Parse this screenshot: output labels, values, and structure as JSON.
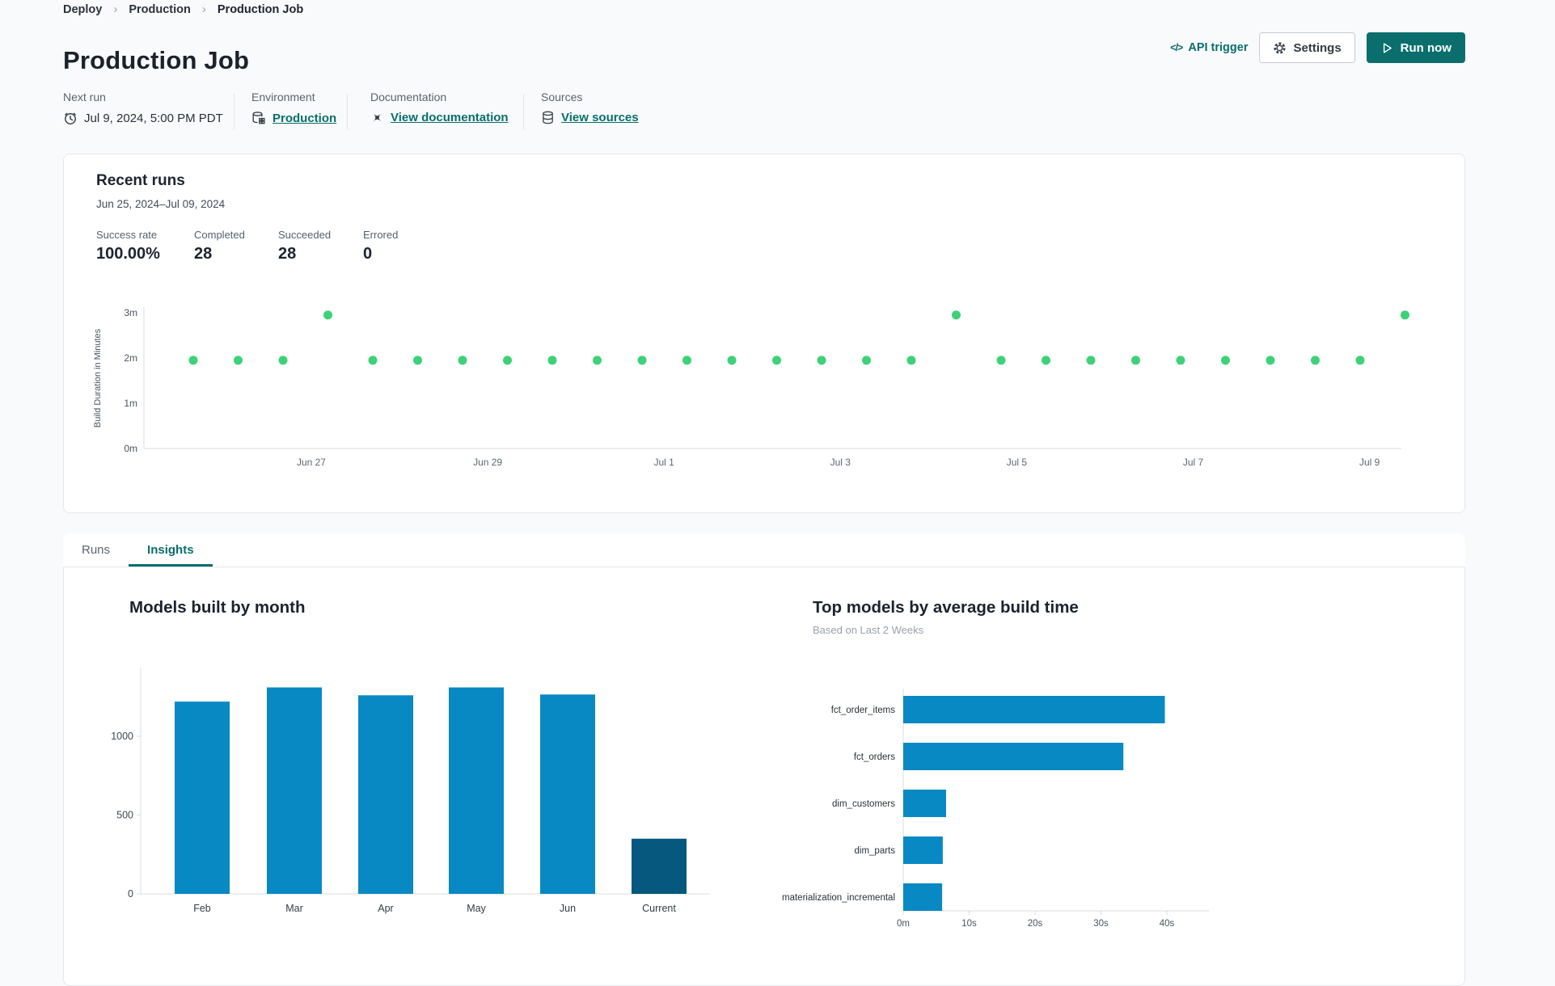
{
  "breadcrumb": {
    "items": [
      "Deploy",
      "Production",
      "Production Job"
    ]
  },
  "header": {
    "title": "Production Job",
    "api_trigger_label": "API trigger",
    "code_glyph": "</>",
    "settings_label": "Settings",
    "run_now_label": "Run now"
  },
  "info": {
    "next_run": {
      "label": "Next run",
      "value": "Jul 9, 2024, 5:00 PM PDT"
    },
    "environment": {
      "label": "Environment",
      "value": "Production"
    },
    "documentation": {
      "label": "Documentation",
      "value": "View documentation"
    },
    "sources": {
      "label": "Sources",
      "value": "View sources"
    }
  },
  "recent_runs": {
    "title": "Recent runs",
    "date_range": "Jun 25, 2024–Jul 09, 2024",
    "stats": [
      {
        "label": "Success rate",
        "value": "100.00%"
      },
      {
        "label": "Completed",
        "value": "28"
      },
      {
        "label": "Succeeded",
        "value": "28"
      },
      {
        "label": "Errored",
        "value": "0"
      }
    ]
  },
  "tabs": [
    {
      "label": "Runs",
      "active": false
    },
    {
      "label": "Insights",
      "active": true
    }
  ],
  "colors": {
    "accent_teal": "#0a6e6d",
    "dot_green": "#3dd278",
    "bar_blue": "#0989c3",
    "bar_dark_blue": "#06587e",
    "axis_line": "#d8dce1"
  },
  "chart_data": [
    {
      "id": "build-duration",
      "type": "scatter",
      "ylabel": "Build Duration in Minutes",
      "y_ticks": [
        "0m",
        "1m",
        "2m",
        "3m"
      ],
      "ylim": [
        0,
        3.15
      ],
      "x_ticks": [
        "Jun 27",
        "Jun 29",
        "Jul 1",
        "Jul 3",
        "Jul 5",
        "Jul 7",
        "Jul 9"
      ],
      "x_tick_run_index": [
        2.63,
        6.56,
        10.49,
        14.42,
        18.35,
        22.28,
        26.21
      ],
      "point_color": "#3dd278",
      "run_durations_minutes": [
        1.95,
        1.95,
        1.95,
        2.95,
        1.95,
        1.95,
        1.95,
        1.95,
        1.95,
        1.95,
        1.95,
        1.95,
        1.95,
        1.95,
        1.95,
        1.95,
        1.95,
        2.95,
        1.95,
        1.95,
        1.95,
        1.95,
        1.95,
        1.95,
        1.95,
        1.95,
        1.95,
        2.95
      ]
    },
    {
      "id": "models-by-month",
      "type": "bar",
      "title": "Models built by month",
      "categories": [
        "Feb",
        "Mar",
        "Apr",
        "May",
        "Jun",
        "Current"
      ],
      "values": [
        1220,
        1310,
        1260,
        1310,
        1265,
        350
      ],
      "y_ticks": [
        0,
        500,
        1000
      ],
      "ylim": [
        0,
        1400
      ],
      "bar_color": "#0989c3",
      "highlight_color": "#06587e",
      "highlight_index": 5,
      "grid": false
    },
    {
      "id": "top-models",
      "type": "horizontal-bar",
      "title": "Top models by average build time",
      "subtitle": "Based on Last 2 Weeks",
      "categories": [
        "fct_order_items",
        "fct_orders",
        "dim_customers",
        "dim_parts",
        "materialization_incremental"
      ],
      "values_seconds": [
        39.7,
        33.4,
        6.5,
        6.0,
        5.9
      ],
      "x_ticks": [
        "0m",
        "10s",
        "20s",
        "30s",
        "40s"
      ],
      "x_tick_seconds": [
        0,
        10,
        20,
        30,
        40
      ],
      "xlim": [
        0,
        45
      ],
      "bar_color": "#0989c3",
      "grid": false
    }
  ]
}
